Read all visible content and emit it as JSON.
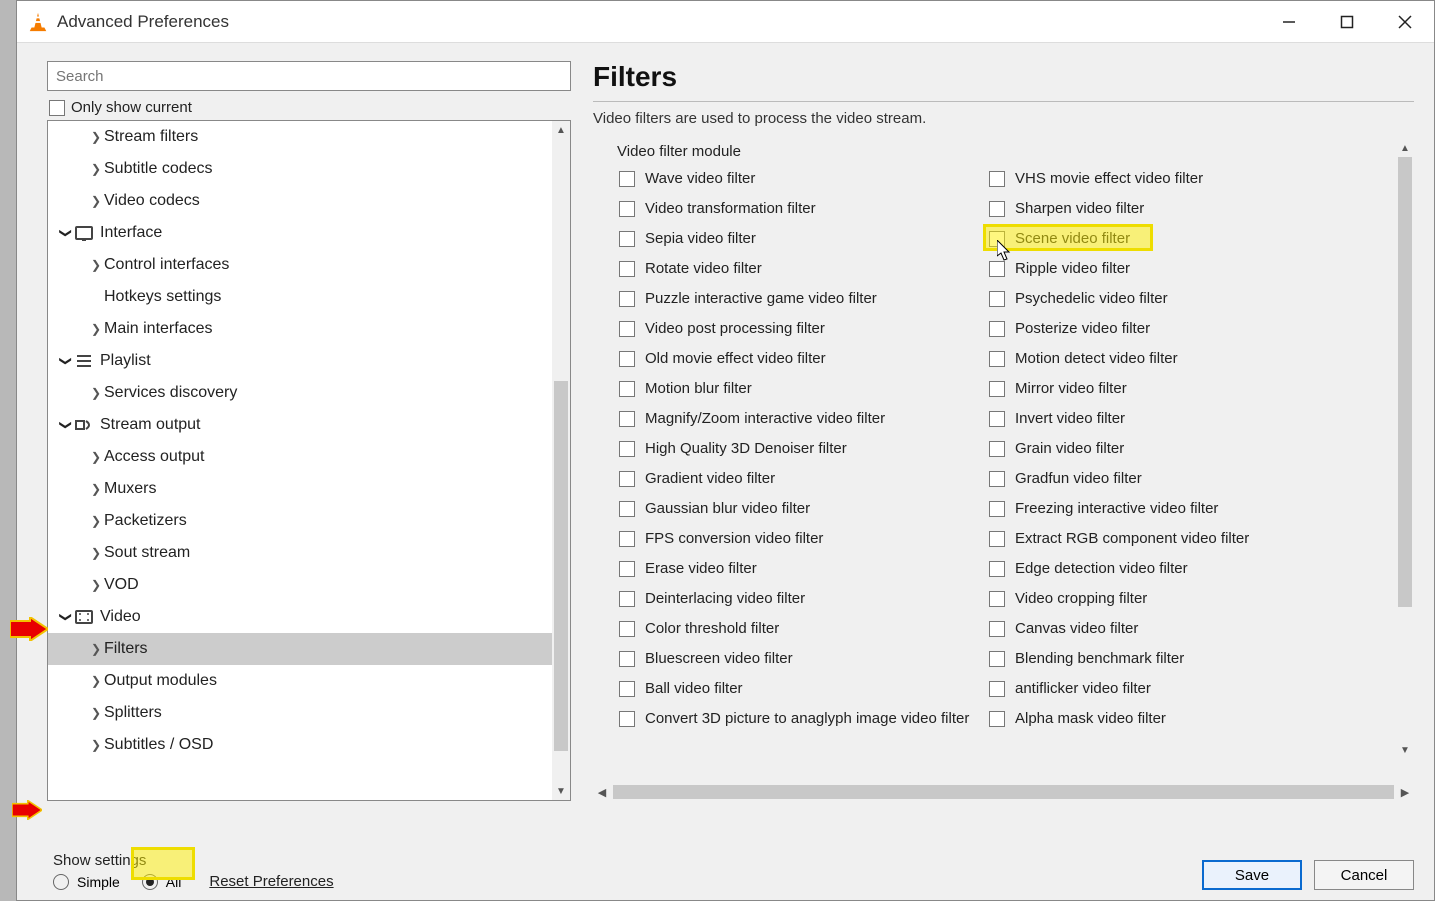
{
  "window": {
    "title": "Advanced Preferences"
  },
  "search": {
    "placeholder": "Search"
  },
  "only_current_label": "Only show current",
  "tree": {
    "items": [
      {
        "level": 2,
        "expander": ">",
        "label": "Stream filters"
      },
      {
        "level": 2,
        "expander": ">",
        "label": "Subtitle codecs"
      },
      {
        "level": 2,
        "expander": ">",
        "label": "Video codecs"
      },
      {
        "level": 1,
        "expander": "v",
        "icon": "interface",
        "label": "Interface"
      },
      {
        "level": 2,
        "expander": ">",
        "label": "Control interfaces"
      },
      {
        "level": 2,
        "expander": "",
        "label": "Hotkeys settings"
      },
      {
        "level": 2,
        "expander": ">",
        "label": "Main interfaces"
      },
      {
        "level": 1,
        "expander": "v",
        "icon": "playlist",
        "label": "Playlist"
      },
      {
        "level": 2,
        "expander": ">",
        "label": "Services discovery"
      },
      {
        "level": 1,
        "expander": "v",
        "icon": "stream",
        "label": "Stream output"
      },
      {
        "level": 2,
        "expander": ">",
        "label": "Access output"
      },
      {
        "level": 2,
        "expander": ">",
        "label": "Muxers"
      },
      {
        "level": 2,
        "expander": ">",
        "label": "Packetizers"
      },
      {
        "level": 2,
        "expander": ">",
        "label": "Sout stream"
      },
      {
        "level": 2,
        "expander": ">",
        "label": "VOD"
      },
      {
        "level": 1,
        "expander": "v",
        "icon": "video",
        "label": "Video",
        "annotated": true
      },
      {
        "level": 2,
        "expander": ">",
        "label": "Filters",
        "selected": true
      },
      {
        "level": 2,
        "expander": ">",
        "label": "Output modules"
      },
      {
        "level": 2,
        "expander": ">",
        "label": "Splitters"
      },
      {
        "level": 2,
        "expander": ">",
        "label": "Subtitles / OSD"
      }
    ]
  },
  "right": {
    "heading": "Filters",
    "description": "Video filters are used to process the video stream.",
    "module_label": "Video filter module"
  },
  "filters": {
    "left": [
      "Wave video filter",
      "Video transformation filter",
      "Sepia video filter",
      "Rotate video filter",
      "Puzzle interactive game video filter",
      "Video post processing filter",
      "Old movie effect video filter",
      "Motion blur filter",
      "Magnify/Zoom interactive video filter",
      "High Quality 3D Denoiser filter",
      "Gradient video filter",
      "Gaussian blur video filter",
      "FPS conversion video filter",
      "Erase video filter",
      "Deinterlacing video filter",
      "Color threshold filter",
      "Bluescreen video filter",
      "Ball video filter",
      "Convert 3D picture to anaglyph image video filter"
    ],
    "right": [
      "VHS movie effect video filter",
      "Sharpen video filter",
      "Scene video filter",
      "Ripple video filter",
      "Psychedelic video filter",
      "Posterize video filter",
      "Motion detect video filter",
      "Mirror video filter",
      "Invert video filter",
      "Grain video filter",
      "Gradfun video filter",
      "Freezing interactive video filter",
      "Extract RGB component video filter",
      "Edge detection video filter",
      "Video cropping filter",
      "Canvas video filter",
      "Blending benchmark filter",
      "antiflicker video filter",
      "Alpha mask video filter"
    ],
    "highlighted_right_index": 2
  },
  "footer": {
    "show_settings_label": "Show settings",
    "radio_simple": "Simple",
    "radio_all": "All",
    "reset": "Reset Preferences",
    "save": "Save",
    "cancel": "Cancel"
  }
}
